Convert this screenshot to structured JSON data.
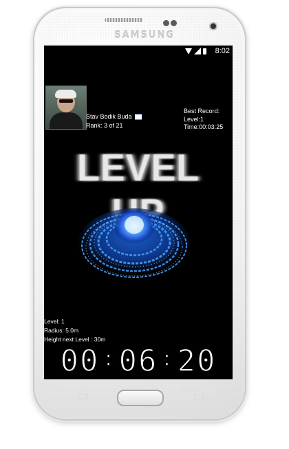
{
  "device": {
    "brand": "SAMSUNG"
  },
  "status_bar": {
    "time": "8:02"
  },
  "player": {
    "name": "Stav Bodik Buda",
    "rank": "Rank: 3 of 21"
  },
  "best_record": {
    "label": "Best Record:",
    "level": "Level:1",
    "time": "Time:00:03:25"
  },
  "banner": {
    "text": "LEVEL UP"
  },
  "stats": {
    "level": "Level: 1",
    "radius": "Radius: 5.0m",
    "height_next": "Height next Level : 30m"
  },
  "timer": {
    "h": "00",
    "m": "06",
    "s": "20"
  },
  "colors": {
    "screen_bg": "#000000",
    "portal_glow": "#3a8cff"
  }
}
